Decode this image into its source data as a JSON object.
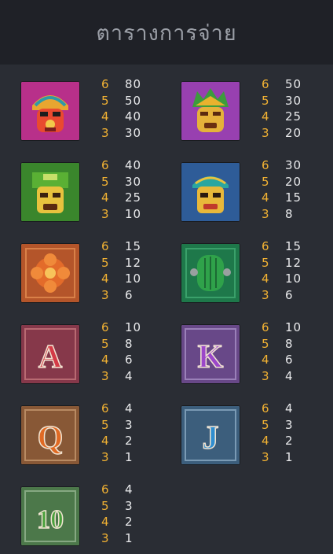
{
  "header": {
    "title": "ตารางการจ่าย"
  },
  "symbols": [
    {
      "name": "red-mask",
      "icon": "red-aztec-mask-icon",
      "bg": "#c2358e",
      "pays": [
        {
          "count": "6",
          "value": "80"
        },
        {
          "count": "5",
          "value": "50"
        },
        {
          "count": "4",
          "value": "40"
        },
        {
          "count": "3",
          "value": "30"
        }
      ]
    },
    {
      "name": "purple-mask",
      "icon": "purple-aztec-mask-icon",
      "bg": "#9b3fb3",
      "pays": [
        {
          "count": "6",
          "value": "50"
        },
        {
          "count": "5",
          "value": "30"
        },
        {
          "count": "4",
          "value": "25"
        },
        {
          "count": "3",
          "value": "20"
        }
      ]
    },
    {
      "name": "green-mask",
      "icon": "green-aztec-mask-icon",
      "bg": "#3e8a2e",
      "pays": [
        {
          "count": "6",
          "value": "40"
        },
        {
          "count": "5",
          "value": "30"
        },
        {
          "count": "4",
          "value": "25"
        },
        {
          "count": "3",
          "value": "10"
        }
      ]
    },
    {
      "name": "blue-mask",
      "icon": "blue-aztec-mask-icon",
      "bg": "#2f5f9a",
      "pays": [
        {
          "count": "6",
          "value": "30"
        },
        {
          "count": "5",
          "value": "20"
        },
        {
          "count": "4",
          "value": "15"
        },
        {
          "count": "3",
          "value": "8"
        }
      ]
    },
    {
      "name": "orange-flower",
      "icon": "orange-flower-tile-icon",
      "bg": "#b8582a",
      "pays": [
        {
          "count": "6",
          "value": "15"
        },
        {
          "count": "5",
          "value": "12"
        },
        {
          "count": "4",
          "value": "10"
        },
        {
          "count": "3",
          "value": "6"
        }
      ]
    },
    {
      "name": "green-cactus",
      "icon": "green-cactus-tile-icon",
      "bg": "#1f7a4c",
      "pays": [
        {
          "count": "6",
          "value": "15"
        },
        {
          "count": "5",
          "value": "12"
        },
        {
          "count": "4",
          "value": "10"
        },
        {
          "count": "3",
          "value": "6"
        }
      ]
    },
    {
      "name": "letter-a",
      "icon": "letter-a-card-icon",
      "bg": "#8a3a48",
      "letter": "A",
      "letter_color": "#d43b47",
      "pays": [
        {
          "count": "6",
          "value": "10"
        },
        {
          "count": "5",
          "value": "8"
        },
        {
          "count": "4",
          "value": "6"
        },
        {
          "count": "3",
          "value": "4"
        }
      ]
    },
    {
      "name": "letter-k",
      "icon": "letter-k-card-icon",
      "bg": "#6a4a88",
      "letter": "K",
      "letter_color": "#9b47c9",
      "pays": [
        {
          "count": "6",
          "value": "10"
        },
        {
          "count": "5",
          "value": "8"
        },
        {
          "count": "4",
          "value": "6"
        },
        {
          "count": "3",
          "value": "4"
        }
      ]
    },
    {
      "name": "letter-q",
      "icon": "letter-q-card-icon",
      "bg": "#8a5a36",
      "letter": "Q",
      "letter_color": "#e06a24",
      "pays": [
        {
          "count": "6",
          "value": "4"
        },
        {
          "count": "5",
          "value": "3"
        },
        {
          "count": "4",
          "value": "2"
        },
        {
          "count": "3",
          "value": "1"
        }
      ]
    },
    {
      "name": "letter-j",
      "icon": "letter-j-card-icon",
      "bg": "#3d607e",
      "letter": "J",
      "letter_color": "#2f8ed0",
      "pays": [
        {
          "count": "6",
          "value": "4"
        },
        {
          "count": "5",
          "value": "3"
        },
        {
          "count": "4",
          "value": "2"
        },
        {
          "count": "3",
          "value": "1"
        }
      ]
    },
    {
      "name": "number-10",
      "icon": "number-10-card-icon",
      "bg": "#4e7a4a",
      "letter": "10",
      "letter_color": "#4aa13d",
      "pays": [
        {
          "count": "6",
          "value": "4"
        },
        {
          "count": "5",
          "value": "3"
        },
        {
          "count": "4",
          "value": "2"
        },
        {
          "count": "3",
          "value": "1"
        }
      ]
    }
  ]
}
